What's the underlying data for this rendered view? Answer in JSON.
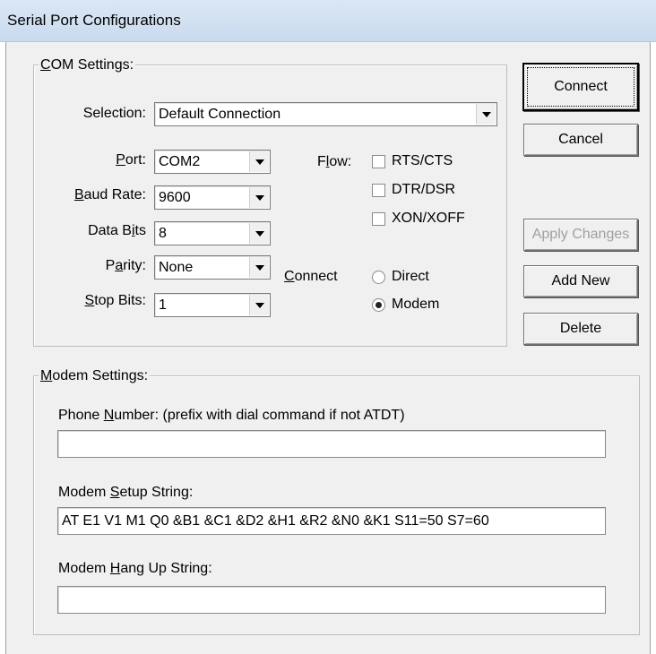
{
  "window": {
    "title": "Serial Port Configurations"
  },
  "com_settings": {
    "group_label_prefix": "C",
    "group_label_rest": "OM Settings:",
    "selection": {
      "label": "Selection:",
      "value": "Default Connection"
    },
    "port": {
      "label_u": "P",
      "label_rest": "ort:",
      "value": "COM2"
    },
    "baud_rate": {
      "label_u": "B",
      "label_rest": "aud Rate:",
      "value": "9600"
    },
    "data_bits": {
      "label_pre": "Data B",
      "label_u": "i",
      "label_rest": "ts",
      "value": "8"
    },
    "parity": {
      "label_pre": "P",
      "label_u": "a",
      "label_rest": "rity:",
      "value": "None"
    },
    "stop_bits": {
      "label_u": "S",
      "label_rest": "top Bits:",
      "value": "1"
    },
    "flow": {
      "label_pre": "F",
      "label_u": "l",
      "label_rest": "ow:",
      "options": [
        {
          "label": "RTS/CTS",
          "checked": false
        },
        {
          "label": "DTR/DSR",
          "checked": false
        },
        {
          "label": "XON/XOFF",
          "checked": false
        }
      ]
    },
    "connect": {
      "label_u": "C",
      "label_rest": "onnect",
      "options": [
        {
          "label": "Direct",
          "selected": false
        },
        {
          "label": "Modem",
          "selected": true
        }
      ]
    }
  },
  "buttons": {
    "connect": "Connect",
    "cancel": "Cancel",
    "apply_changes": "Apply Changes",
    "add_new": "Add New",
    "delete": "Delete"
  },
  "modem_settings": {
    "group_label_prefix": "M",
    "group_label_rest": "odem Settings:",
    "phone_number": {
      "label_pre": "Phone ",
      "label_u": "N",
      "label_rest": "umber: (prefix with dial command if not ATDT)",
      "value": ""
    },
    "setup_string": {
      "label_pre": "Modem ",
      "label_u": "S",
      "label_rest": "etup String:",
      "value": "AT E1 V1 M1 Q0 &B1 &C1 &D2 &H1 &R2 &N0 &K1 S11=50 S7=60"
    },
    "hangup_string": {
      "label_pre": "Modem ",
      "label_u": "H",
      "label_rest": "ang Up String:",
      "value": ""
    }
  }
}
